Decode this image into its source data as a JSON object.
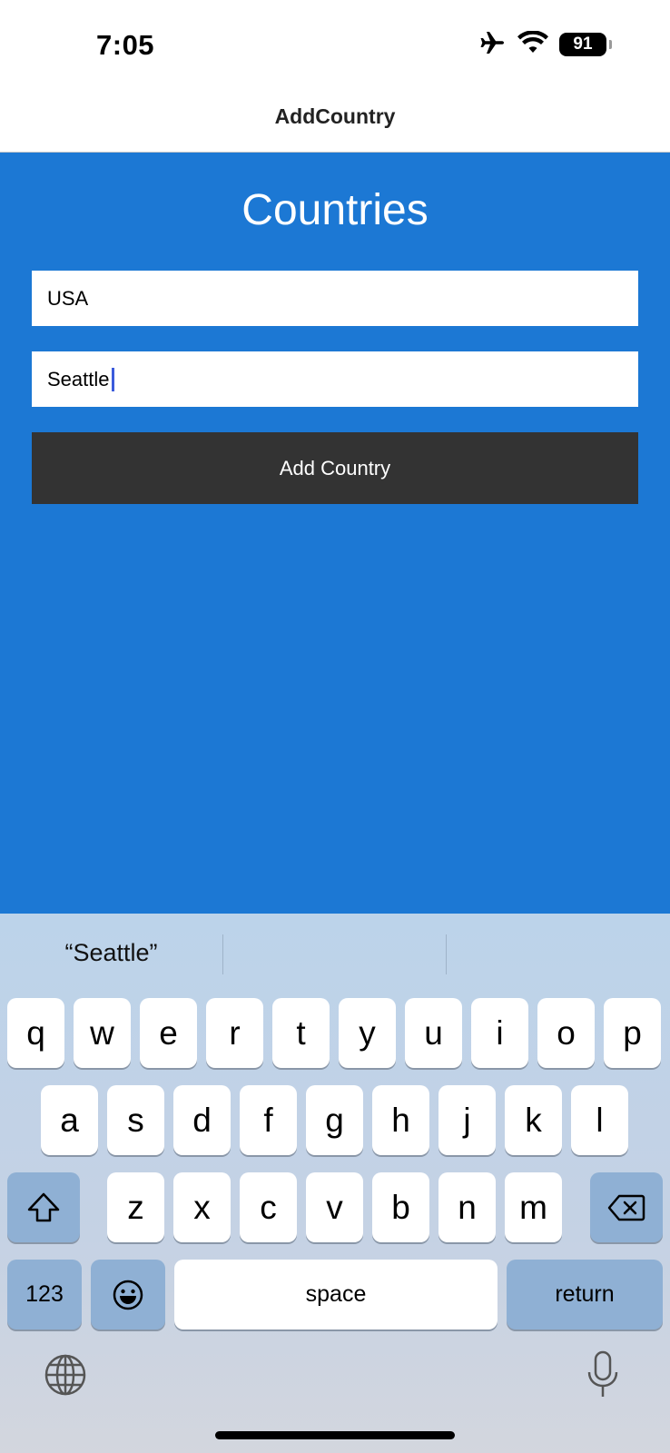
{
  "status_bar": {
    "time": "7:05",
    "battery": "91"
  },
  "nav": {
    "title": "AddCountry"
  },
  "page": {
    "title": "Countries"
  },
  "form": {
    "country_value": "USA",
    "city_value": "Seattle",
    "add_button_label": "Add Country"
  },
  "keyboard": {
    "suggestions": [
      "“Seattle”",
      "",
      ""
    ],
    "row1": [
      "q",
      "w",
      "e",
      "r",
      "t",
      "y",
      "u",
      "i",
      "o",
      "p"
    ],
    "row2": [
      "a",
      "s",
      "d",
      "f",
      "g",
      "h",
      "j",
      "k",
      "l"
    ],
    "row3": [
      "z",
      "x",
      "c",
      "v",
      "b",
      "n",
      "m"
    ],
    "numbers_label": "123",
    "space_label": "space",
    "return_label": "return"
  },
  "colors": {
    "content_bg": "#1c78d4",
    "button_bg": "#333333",
    "caret": "#3b5bdb"
  }
}
